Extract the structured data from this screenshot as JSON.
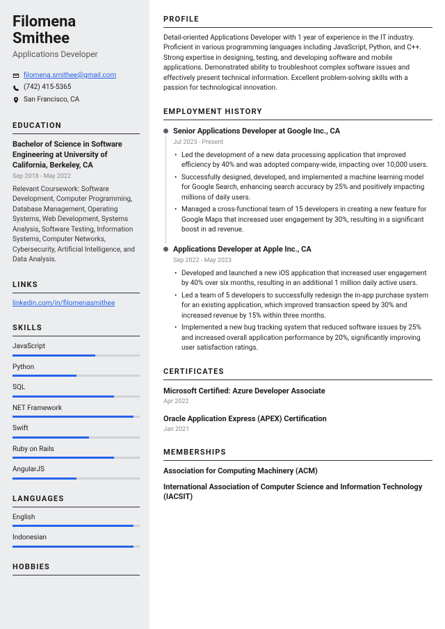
{
  "name_first": "Filomena",
  "name_last": "Smithee",
  "title": "Applications Developer",
  "email": "filomena.smithee@gmail.com",
  "phone": "(742) 415-5365",
  "location": "San Francisco, CA",
  "sections": {
    "education": "EDUCATION",
    "links": "LINKS",
    "skills": "SKILLS",
    "languages": "LANGUAGES",
    "hobbies": "HOBBIES",
    "profile": "PROFILE",
    "employment": "EMPLOYMENT HISTORY",
    "certificates": "CERTIFICATES",
    "memberships": "MEMBERSHIPS"
  },
  "education": {
    "degree": "Bachelor of Science in Software Engineering at University of California, Berkeley, CA",
    "dates": "Sep 2018 - May 2022",
    "coursework": "Relevant Coursework: Software Development, Computer Programming, Database Management, Operating Systems, Web Development, Systems Analysis, Software Testing, Information Systems, Computer Networks, Cybersecurity, Artificial Intelligence, and Data Analysis."
  },
  "link_text": "linkedin.com/in/filomenasmithee",
  "skills": [
    {
      "name": "JavaScript",
      "level": 65
    },
    {
      "name": "Python",
      "level": 50
    },
    {
      "name": "SQL",
      "level": 80
    },
    {
      "name": "NET Framework",
      "level": 95
    },
    {
      "name": "Swift",
      "level": 60
    },
    {
      "name": "Ruby on Rails",
      "level": 80
    },
    {
      "name": "AngularJS",
      "level": 50
    }
  ],
  "languages": [
    {
      "name": "English",
      "level": 95
    },
    {
      "name": "Indonesian",
      "level": 95
    }
  ],
  "profile": "Detail-oriented Applications Developer with 1 year of experience in the IT industry. Proficient in various programming languages including JavaScript, Python, and C++. Strong expertise in designing, testing, and developing software and mobile applications. Demonstrated ability to troubleshoot complex software issues and effectively present technical information. Excellent problem-solving skills with a passion for technological innovation.",
  "jobs": [
    {
      "title": "Senior Applications Developer at Google Inc., CA",
      "dates": "Jul 2023 - Present",
      "bullets": [
        "Led the development of a new data processing application that improved efficiency by 40% and was adopted company-wide, impacting over 10,000 users.",
        "Successfully designed, developed, and implemented a machine learning model for Google Search, enhancing search accuracy by 25% and positively impacting millions of daily users.",
        "Managed a cross-functional team of 15 developers in creating a new feature for Google Maps that increased user engagement by 30%, resulting in a significant boost in ad revenue."
      ]
    },
    {
      "title": "Applications Developer at Apple Inc., CA",
      "dates": "Sep 2022 - May 2023",
      "bullets": [
        "Developed and launched a new iOS application that increased user engagement by 40% over six months, resulting in an additional 1 million daily active users.",
        "Led a team of 5 developers to successfully redesign the in-app purchase system for an existing application, which improved transaction speed by 30% and increased revenue by 15% within three months.",
        "Implemented a new bug tracking system that reduced software issues by 25% and increased overall application performance by 20%, significantly improving user satisfaction ratings."
      ]
    }
  ],
  "certs": [
    {
      "title": "Microsoft Certified: Azure Developer Associate",
      "date": "Apr 2022"
    },
    {
      "title": "Oracle Application Express (APEX) Certification",
      "date": "Jan 2021"
    }
  ],
  "members": [
    "Association for Computing Machinery (ACM)",
    "International Association of Computer Science and Information Technology (IACSIT)"
  ]
}
